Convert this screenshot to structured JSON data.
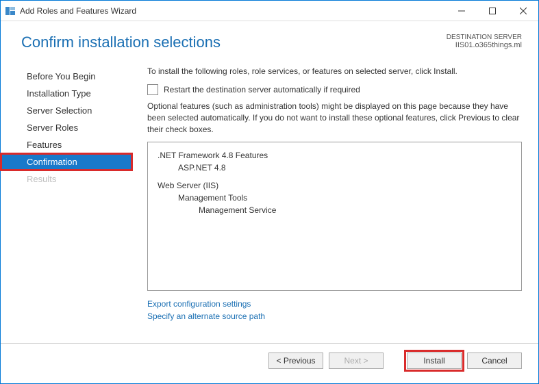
{
  "window": {
    "title": "Add Roles and Features Wizard"
  },
  "header": {
    "title": "Confirm installation selections",
    "destination_label": "DESTINATION SERVER",
    "destination_server": "IIS01.o365things.ml"
  },
  "sidebar": {
    "steps": [
      {
        "label": "Before You Begin",
        "state": "normal"
      },
      {
        "label": "Installation Type",
        "state": "normal"
      },
      {
        "label": "Server Selection",
        "state": "normal"
      },
      {
        "label": "Server Roles",
        "state": "normal"
      },
      {
        "label": "Features",
        "state": "normal"
      },
      {
        "label": "Confirmation",
        "state": "active"
      },
      {
        "label": "Results",
        "state": "disabled"
      }
    ]
  },
  "main": {
    "instruction": "To install the following roles, role services, or features on selected server, click Install.",
    "restart_checkbox_label": "Restart the destination server automatically if required",
    "restart_checked": false,
    "optional_note": "Optional features (such as administration tools) might be displayed on this page because they have been selected automatically. If you do not want to install these optional features, click Previous to clear their check boxes.",
    "features": [
      {
        "label": ".NET Framework 4.8 Features",
        "level": 0
      },
      {
        "label": "ASP.NET 4.8",
        "level": 1
      },
      {
        "spacer": true
      },
      {
        "label": "Web Server (IIS)",
        "level": 0
      },
      {
        "label": "Management Tools",
        "level": 1
      },
      {
        "label": "Management Service",
        "level": 2
      }
    ],
    "links": {
      "export": "Export configuration settings",
      "alternate_source": "Specify an alternate source path"
    }
  },
  "footer": {
    "previous_label": "< Previous",
    "next_label": "Next >",
    "install_label": "Install",
    "cancel_label": "Cancel",
    "next_enabled": false
  }
}
